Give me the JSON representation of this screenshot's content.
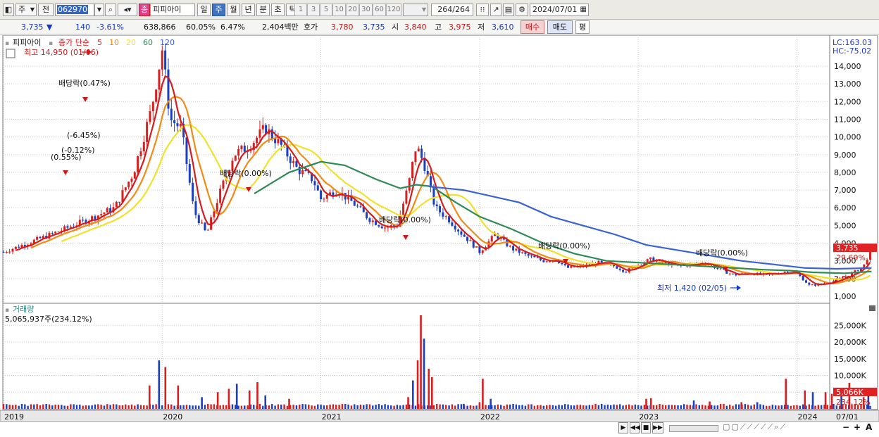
{
  "toolbar": {
    "market": "주",
    "prev": "전",
    "code": "062970",
    "stock_badge": "종",
    "stock_name": "피피아이",
    "periods": [
      "일",
      "주",
      "월",
      "년",
      "분",
      "초",
      "틱"
    ],
    "active_period": "주",
    "numbers": [
      "1",
      "3",
      "5",
      "10",
      "20",
      "30",
      "60",
      "120"
    ],
    "count": "264",
    "count_total": "/264",
    "date": "2024/07/01"
  },
  "quote": {
    "price": "3,735",
    "arrow": "▼",
    "change": "140",
    "change_pct": "-3.61%",
    "volume": "638,866",
    "vol_ratio": "60.05%",
    "turnover": "6.47%",
    "amount": "2,404백만",
    "hoga_label": "호가",
    "ask": "3,780",
    "bid": "3,735",
    "open_label": "시",
    "open": "3,840",
    "high_label": "고",
    "high": "3,975",
    "low_label": "저",
    "low": "3,610",
    "buy": "매수",
    "sell": "매도",
    "flat": "평"
  },
  "colors": {
    "up": "#d91e1e",
    "down": "#1a3fc4",
    "ma5": "#d61c1c",
    "ma10": "#f28a14",
    "ma20": "#f2e12a",
    "ma60": "#2e8b57",
    "ma120": "#3a62d8"
  },
  "chart_data": {
    "type": "candlestick",
    "legend": {
      "name": "피피아이",
      "label": "종가 단순",
      "periods": [
        "5",
        "10",
        "20",
        "60",
        "120"
      ]
    },
    "lc": "LC:163.03",
    "hc": "HC:-75.02",
    "y_ticks": [
      "14,000",
      "13,000",
      "12,000",
      "11,000",
      "10,000",
      "9,000",
      "8,000",
      "7,000",
      "6,000",
      "5,000",
      "4,000",
      "3,000",
      "2,000",
      "1,000"
    ],
    "ylim": [
      500,
      15300
    ],
    "x_labels": [
      "2019",
      "2020",
      "2021",
      "2022",
      "2023",
      "2024",
      "07/01"
    ],
    "price_points": [
      [
        2019.0,
        3500
      ],
      [
        2019.3,
        4500
      ],
      [
        2019.55,
        5400
      ],
      [
        2019.7,
        6000
      ],
      [
        2019.82,
        8000
      ],
      [
        2019.93,
        11500
      ],
      [
        2020.0,
        14950
      ],
      [
        2020.05,
        11000
      ],
      [
        2020.12,
        10500
      ],
      [
        2020.2,
        5800
      ],
      [
        2020.28,
        4500
      ],
      [
        2020.35,
        6500
      ],
      [
        2020.45,
        9000
      ],
      [
        2020.55,
        9500
      ],
      [
        2020.65,
        10500
      ],
      [
        2020.75,
        9500
      ],
      [
        2020.85,
        8200
      ],
      [
        2020.95,
        7600
      ],
      [
        2021.0,
        6500
      ],
      [
        2021.1,
        7000
      ],
      [
        2021.2,
        6300
      ],
      [
        2021.3,
        5400
      ],
      [
        2021.4,
        4900
      ],
      [
        2021.48,
        5000
      ],
      [
        2021.55,
        7200
      ],
      [
        2021.6,
        9500
      ],
      [
        2021.65,
        8500
      ],
      [
        2021.72,
        6000
      ],
      [
        2021.8,
        5400
      ],
      [
        2021.88,
        4600
      ],
      [
        2021.95,
        4000
      ],
      [
        2022.0,
        3500
      ],
      [
        2022.1,
        4500
      ],
      [
        2022.2,
        3700
      ],
      [
        2022.3,
        3300
      ],
      [
        2022.4,
        3000
      ],
      [
        2022.48,
        3100
      ],
      [
        2022.55,
        2600
      ],
      [
        2022.65,
        2700
      ],
      [
        2022.75,
        2900
      ],
      [
        2022.85,
        2700
      ],
      [
        2022.92,
        2400
      ],
      [
        2023.0,
        2800
      ],
      [
        2023.08,
        3100
      ],
      [
        2023.15,
        2900
      ],
      [
        2023.25,
        2700
      ],
      [
        2023.35,
        2800
      ],
      [
        2023.42,
        2900
      ],
      [
        2023.52,
        2500
      ],
      [
        2023.6,
        2200
      ],
      [
        2023.7,
        2300
      ],
      [
        2023.8,
        2200
      ],
      [
        2023.88,
        2300
      ],
      [
        2023.95,
        2400
      ],
      [
        2024.0,
        2300
      ],
      [
        2024.08,
        1600
      ],
      [
        2024.15,
        1700
      ],
      [
        2024.25,
        1900
      ],
      [
        2024.35,
        2300
      ],
      [
        2024.42,
        2700
      ],
      [
        2024.47,
        3735
      ]
    ],
    "ma_lines": {
      "ma60": [
        [
          2020.58,
          6800
        ],
        [
          2020.8,
          8000
        ],
        [
          2021.0,
          8600
        ],
        [
          2021.15,
          8400
        ],
        [
          2021.35,
          7600
        ],
        [
          2021.5,
          7100
        ],
        [
          2021.6,
          7300
        ],
        [
          2021.7,
          7200
        ],
        [
          2021.85,
          6300
        ],
        [
          2022.0,
          5500
        ],
        [
          2022.2,
          4800
        ],
        [
          2022.4,
          4000
        ],
        [
          2022.6,
          3400
        ],
        [
          2022.8,
          3000
        ],
        [
          2023.0,
          2900
        ],
        [
          2023.2,
          2800
        ],
        [
          2023.4,
          2700
        ],
        [
          2023.6,
          2600
        ],
        [
          2023.8,
          2500
        ],
        [
          2023.95,
          2450
        ],
        [
          2024.1,
          2350
        ],
        [
          2024.3,
          2300
        ],
        [
          2024.47,
          2400
        ]
      ],
      "ma120": [
        [
          2021.68,
          7200
        ],
        [
          2021.9,
          7000
        ],
        [
          2022.05,
          6700
        ],
        [
          2022.25,
          6300
        ],
        [
          2022.45,
          5500
        ],
        [
          2022.65,
          5000
        ],
        [
          2022.85,
          4500
        ],
        [
          2023.05,
          3900
        ],
        [
          2023.25,
          3600
        ],
        [
          2023.45,
          3300
        ],
        [
          2023.65,
          3000
        ],
        [
          2023.85,
          2800
        ],
        [
          2024.05,
          2600
        ],
        [
          2024.25,
          2550
        ],
        [
          2024.47,
          2600
        ]
      ]
    },
    "annotations": {
      "high": "최고 14,950 (01/06)",
      "low": "최저 1,420 (02/05)",
      "dividends": [
        "배당락(0.47%)",
        "배당락(0.00%)",
        "배당락(0.00%)",
        "배당락(0.00%)",
        "배당락(0.00%)"
      ],
      "flags": [
        "(-6.45%)",
        "(-0.12%)",
        "(0.55%)"
      ]
    },
    "price_box": {
      "value": "3,735",
      "pct": "29.69%"
    },
    "volume": {
      "title": "거래량",
      "value": "5,065,937주(234.12%)",
      "y_ticks": [
        "25,000K",
        "20,000K",
        "15,000K",
        "10,000K",
        "5,000K"
      ],
      "ylim": [
        0,
        28000
      ],
      "box_value": "5,066K",
      "box_pct": "234.12%",
      "spikes": [
        [
          2019.92,
          7000
        ],
        [
          2019.98,
          14500
        ],
        [
          2020.02,
          12500
        ],
        [
          2020.1,
          7000
        ],
        [
          2020.25,
          3500
        ],
        [
          2020.35,
          5000
        ],
        [
          2020.42,
          6000
        ],
        [
          2020.47,
          7500
        ],
        [
          2020.55,
          5500
        ],
        [
          2020.6,
          8000
        ],
        [
          2020.65,
          4000
        ],
        [
          2020.8,
          3000
        ],
        [
          2021.55,
          3500
        ],
        [
          2021.58,
          8500
        ],
        [
          2021.61,
          14500
        ],
        [
          2021.63,
          28000
        ],
        [
          2021.65,
          21000
        ],
        [
          2021.68,
          12000
        ],
        [
          2021.7,
          9500
        ],
        [
          2021.9,
          1500
        ],
        [
          2022.0,
          2000
        ],
        [
          2022.02,
          9000
        ],
        [
          2022.07,
          3000
        ],
        [
          2023.05,
          3000
        ],
        [
          2023.08,
          3200
        ],
        [
          2023.35,
          2500
        ],
        [
          2023.45,
          2200
        ],
        [
          2023.65,
          2000
        ],
        [
          2023.75,
          2000
        ],
        [
          2023.93,
          9000
        ],
        [
          2024.05,
          5500
        ],
        [
          2024.1,
          5000
        ],
        [
          2024.18,
          5000
        ],
        [
          2024.22,
          4500
        ],
        [
          2024.28,
          5500
        ],
        [
          2024.33,
          7800
        ],
        [
          2024.42,
          3500
        ],
        [
          2024.45,
          5066
        ]
      ]
    }
  },
  "bottom": {
    "zoom_minus": "−",
    "zoom_plus": "+",
    "auto": "A"
  }
}
